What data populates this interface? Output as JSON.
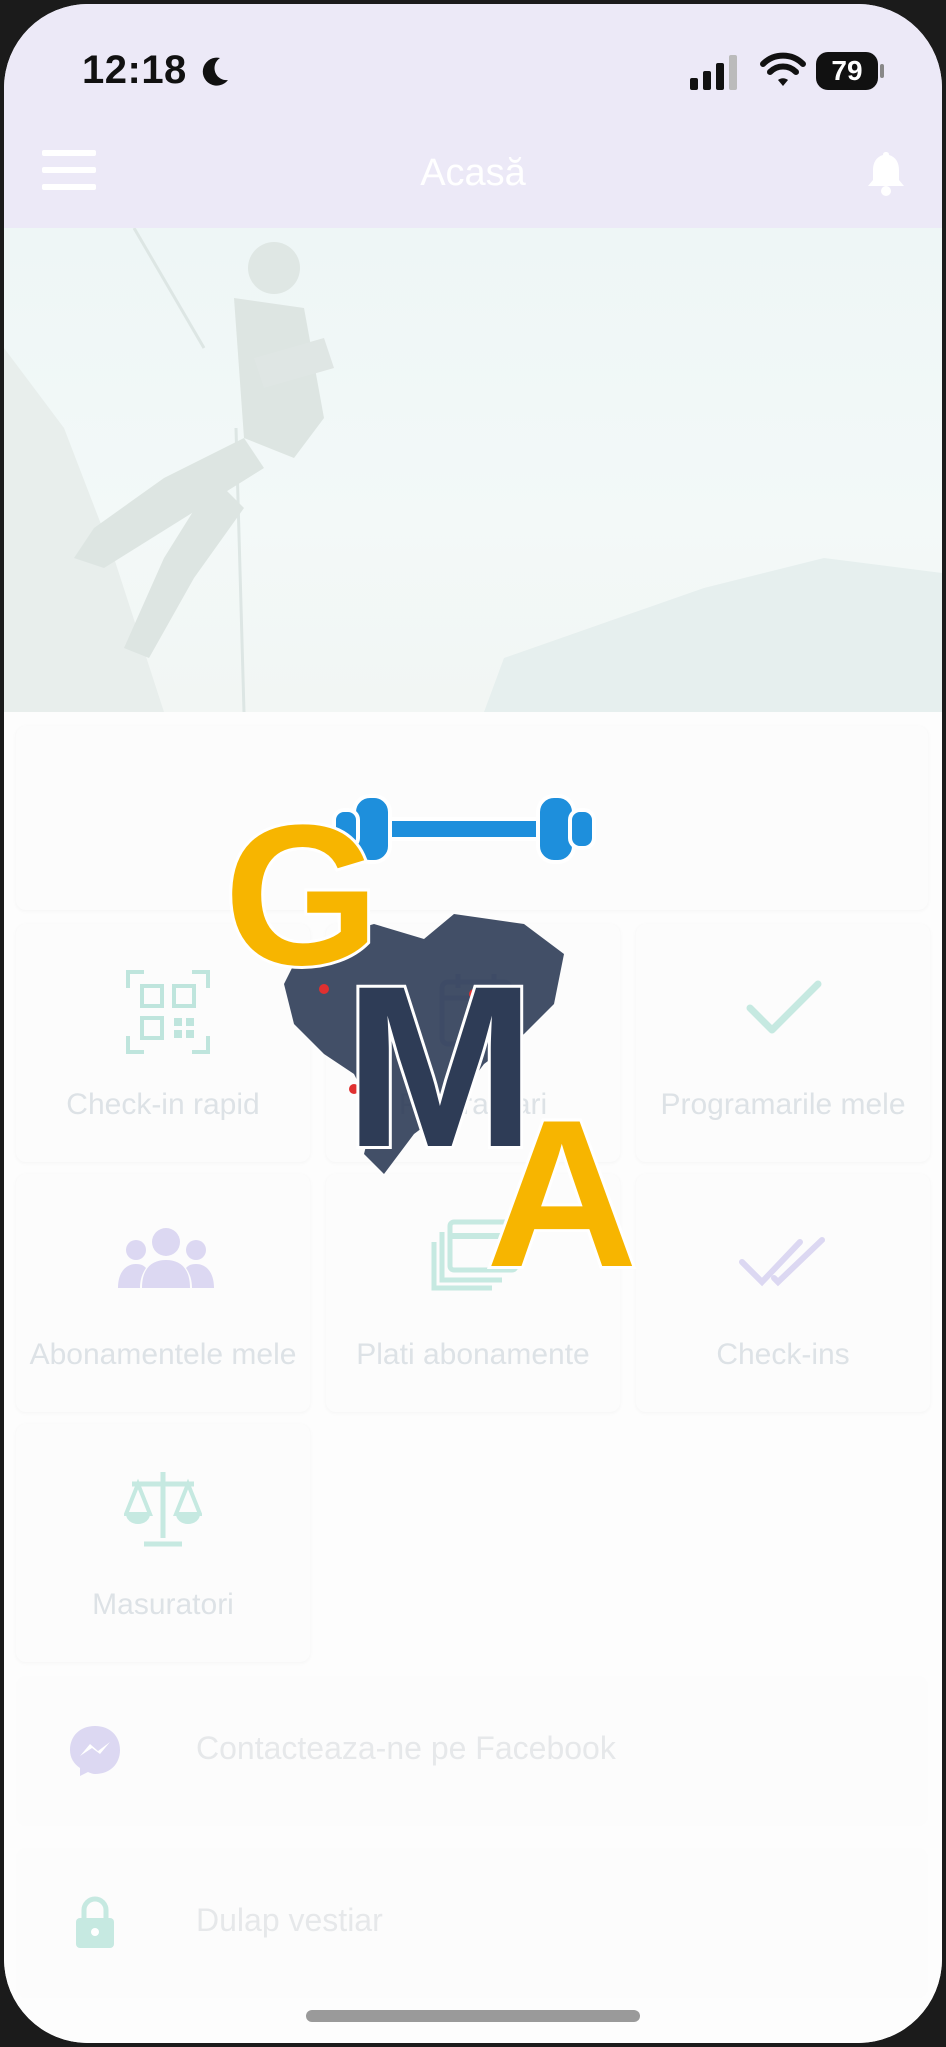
{
  "status_bar": {
    "time": "12:18",
    "battery": "79",
    "moon_icon": "moon-icon",
    "signal_icon": "cellular-signal-icon",
    "wifi_icon": "wifi-icon"
  },
  "nav": {
    "title": "Acasă",
    "menu_icon": "hamburger-menu-icon",
    "bell_icon": "bell-icon"
  },
  "tiles": [
    {
      "label": "Check-in rapid",
      "icon": "qr-code-icon"
    },
    {
      "label": "Programari",
      "icon": "calendar-icon"
    },
    {
      "label": "Programarile mele",
      "icon": "checkmark-icon"
    },
    {
      "label": "Abonamentele mele",
      "icon": "users-icon"
    },
    {
      "label": "Plati abonamente",
      "icon": "payment-cards-icon"
    },
    {
      "label": "Check-ins",
      "icon": "double-check-icon"
    },
    {
      "label": "Masuratori",
      "icon": "scale-icon"
    }
  ],
  "list": [
    {
      "label": "Contacteaza-ne pe Facebook",
      "icon": "messenger-icon"
    },
    {
      "label": "Dulap vestiar",
      "icon": "lock-icon"
    }
  ],
  "logo": {
    "letters": [
      "G",
      "M",
      "A"
    ]
  },
  "colors": {
    "accent_teal": "#b9e3dc",
    "accent_purple": "#dcd8f2",
    "header_bg": "#ece9f7",
    "logo_yellow": "#f7b500",
    "logo_navy": "#2e3c56",
    "logo_blue": "#1e8fdc"
  }
}
